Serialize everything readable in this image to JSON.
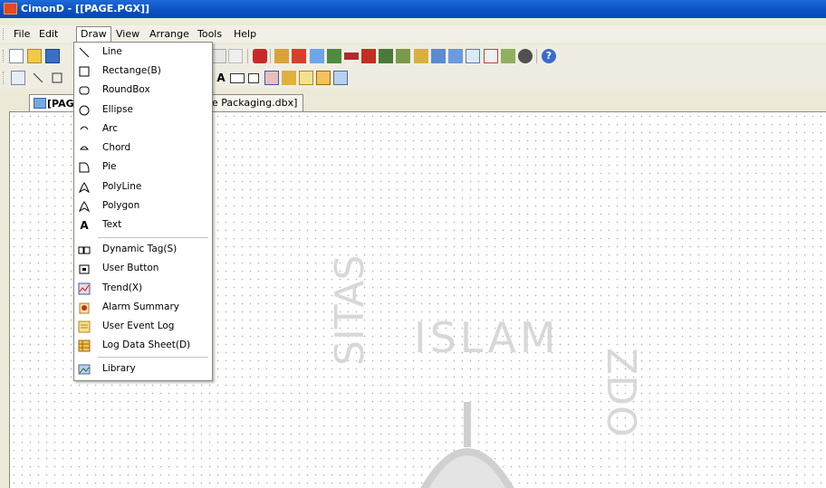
{
  "window": {
    "title": "CimonD - [[PAGE.PGX]]"
  },
  "menubar": [
    "File",
    "Edit",
    "Draw",
    "View",
    "Arrange",
    "Tools",
    "Help"
  ],
  "tabs": {
    "active_label": "[PAG",
    "second_label": "e Packaging.dbx]"
  },
  "watermark": {
    "text": "ISLAM",
    "left_text": "SITAS",
    "right_text": "ZDO"
  },
  "draw_menu": [
    {
      "label": "Line",
      "icon": "line-icon"
    },
    {
      "label": "Rectange(B)",
      "icon": "rectangle-icon"
    },
    {
      "label": "RoundBox",
      "icon": "roundbox-icon"
    },
    {
      "label": "Ellipse",
      "icon": "ellipse-icon"
    },
    {
      "label": "Arc",
      "icon": "arc-icon"
    },
    {
      "label": "Chord",
      "icon": "chord-icon"
    },
    {
      "label": "Pie",
      "icon": "pie-icon"
    },
    {
      "label": "PolyLine",
      "icon": "polyline-icon"
    },
    {
      "label": "Polygon",
      "icon": "polygon-icon"
    },
    {
      "label": "Text",
      "icon": "text-icon"
    },
    {
      "label": "Dynamic Tag(S)",
      "icon": "dynamic-tag-icon"
    },
    {
      "label": "User Button",
      "icon": "user-button-icon"
    },
    {
      "label": "Trend(X)",
      "icon": "trend-icon"
    },
    {
      "label": "Alarm Summary",
      "icon": "alarm-summary-icon"
    },
    {
      "label": "User Event Log",
      "icon": "user-event-log-icon"
    },
    {
      "label": "Log Data Sheet(D)",
      "icon": "log-data-sheet-icon"
    },
    {
      "label": "Library",
      "icon": "library-icon"
    }
  ],
  "colors": {
    "titlebar": "#0a4fc2",
    "menu_bg": "#ffffff",
    "canvas_bg": "#ffffff"
  }
}
